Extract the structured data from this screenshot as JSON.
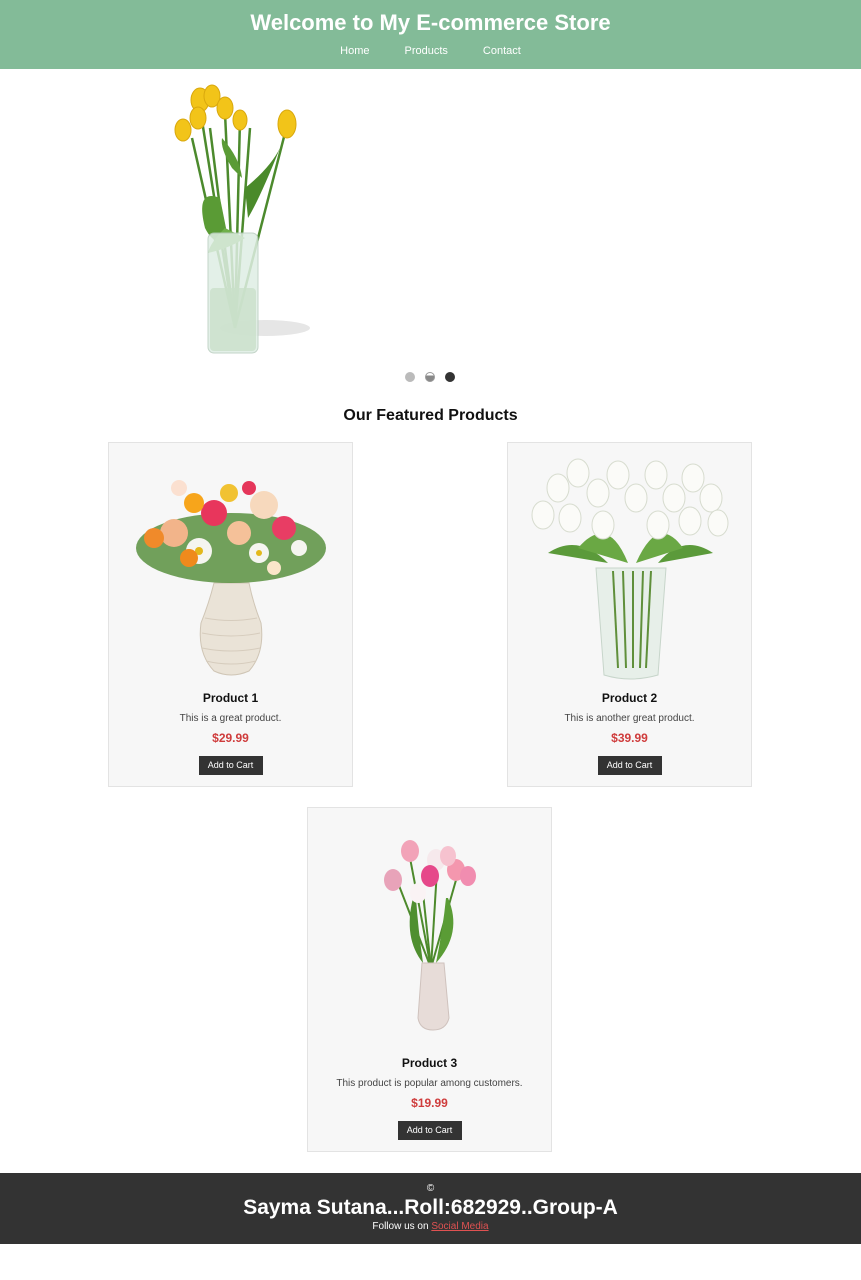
{
  "header": {
    "title": "Welcome to My E-commerce Store",
    "nav": [
      "Home",
      "Products",
      "Contact"
    ],
    "background": "#83bb98"
  },
  "slider": {
    "slide_count": 3,
    "active_index": 2
  },
  "featured": {
    "title": "Our Featured Products",
    "products": [
      {
        "name": "Product 1",
        "description": "This is a great product.",
        "price": "$29.99",
        "button": "Add to Cart"
      },
      {
        "name": "Product 2",
        "description": "This is another great product.",
        "price": "$39.99",
        "button": "Add to Cart"
      },
      {
        "name": "Product 3",
        "description": "This product is popular among customers.",
        "price": "$19.99",
        "button": "Add to Cart"
      }
    ]
  },
  "footer": {
    "copyright": "©",
    "name": "Sayma Sutana...Roll:682929..Group-A",
    "follow_text": "Follow us on",
    "follow_link": "Social Media"
  },
  "colors": {
    "price": "#cf3c3c",
    "button": "#333333",
    "footer": "#333333",
    "link": "#e05252"
  }
}
